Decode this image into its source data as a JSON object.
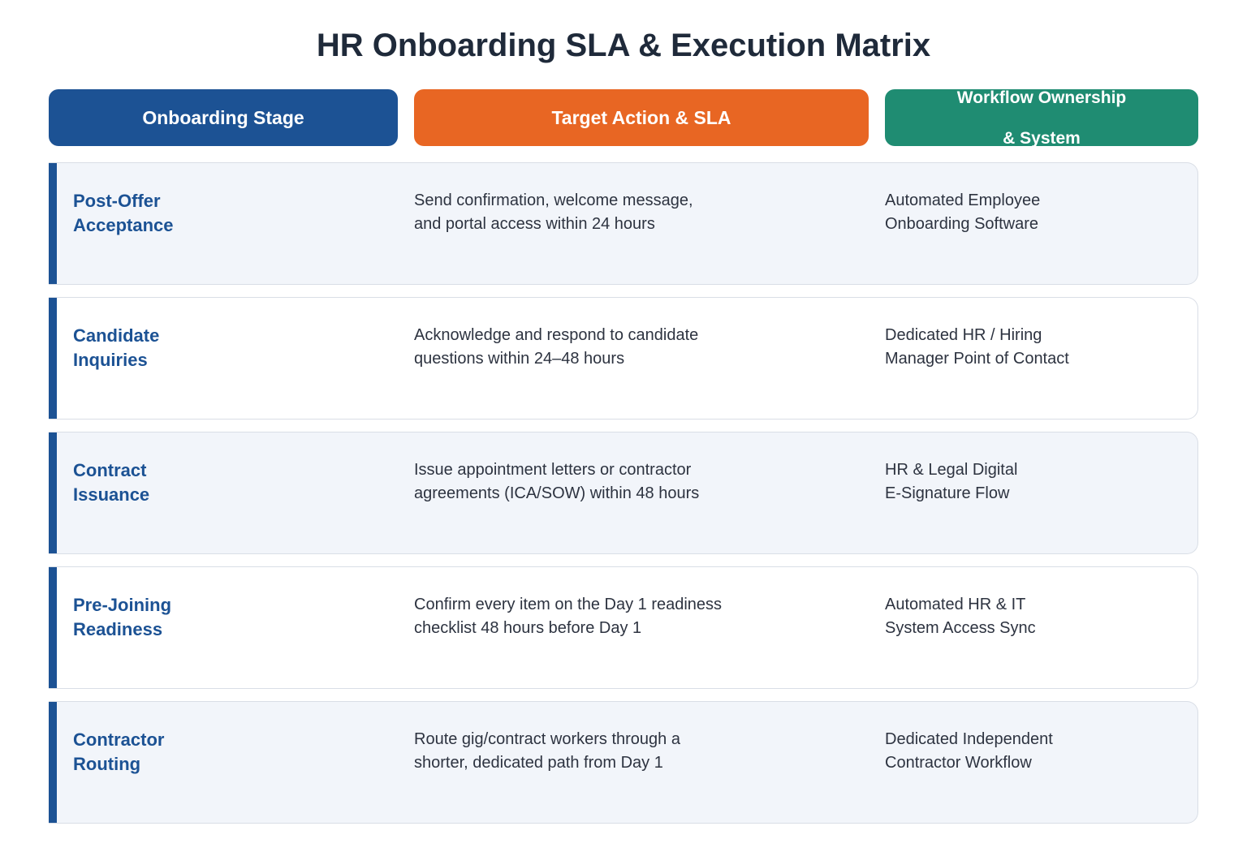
{
  "title": "HR Onboarding SLA & Execution Matrix",
  "headers": [
    {
      "lines": [
        "Onboarding Stage"
      ],
      "color": "#1c5294"
    },
    {
      "lines": [
        "Target Action & SLA"
      ],
      "color": "#e86623"
    },
    {
      "lines": [
        "Workflow Ownership",
        "& System"
      ],
      "color": "#1f8c72"
    }
  ],
  "rows": [
    {
      "stage": [
        "Post-Offer",
        "Acceptance"
      ],
      "action": [
        "Send confirmation, welcome message,",
        "and portal access within 24 hours"
      ],
      "owner": [
        "Automated Employee",
        "Onboarding Software"
      ]
    },
    {
      "stage": [
        "Candidate",
        "Inquiries"
      ],
      "action": [
        "Acknowledge and respond to candidate",
        "questions within 24–48 hours"
      ],
      "owner": [
        "Dedicated HR / Hiring",
        "Manager Point of Contact"
      ]
    },
    {
      "stage": [
        "Contract",
        "Issuance"
      ],
      "action": [
        "Issue appointment letters or contractor",
        "agreements (ICA/SOW) within 48 hours"
      ],
      "owner": [
        "HR & Legal Digital",
        "E-Signature Flow"
      ]
    },
    {
      "stage": [
        "Pre-Joining",
        "Readiness"
      ],
      "action": [
        "Confirm every item on the Day 1 readiness",
        "checklist 48 hours before Day 1"
      ],
      "owner": [
        "Automated HR & IT",
        "System Access Sync"
      ]
    },
    {
      "stage": [
        "Contractor",
        "Routing"
      ],
      "action": [
        "Route gig/contract workers through a",
        "shorter, dedicated path from Day 1"
      ],
      "owner": [
        "Dedicated Independent",
        "Contractor Workflow"
      ]
    }
  ],
  "colors": {
    "stage_accent": "#1c5294",
    "row_shaded": "#f2f5fa",
    "row_plain": "#ffffff"
  }
}
